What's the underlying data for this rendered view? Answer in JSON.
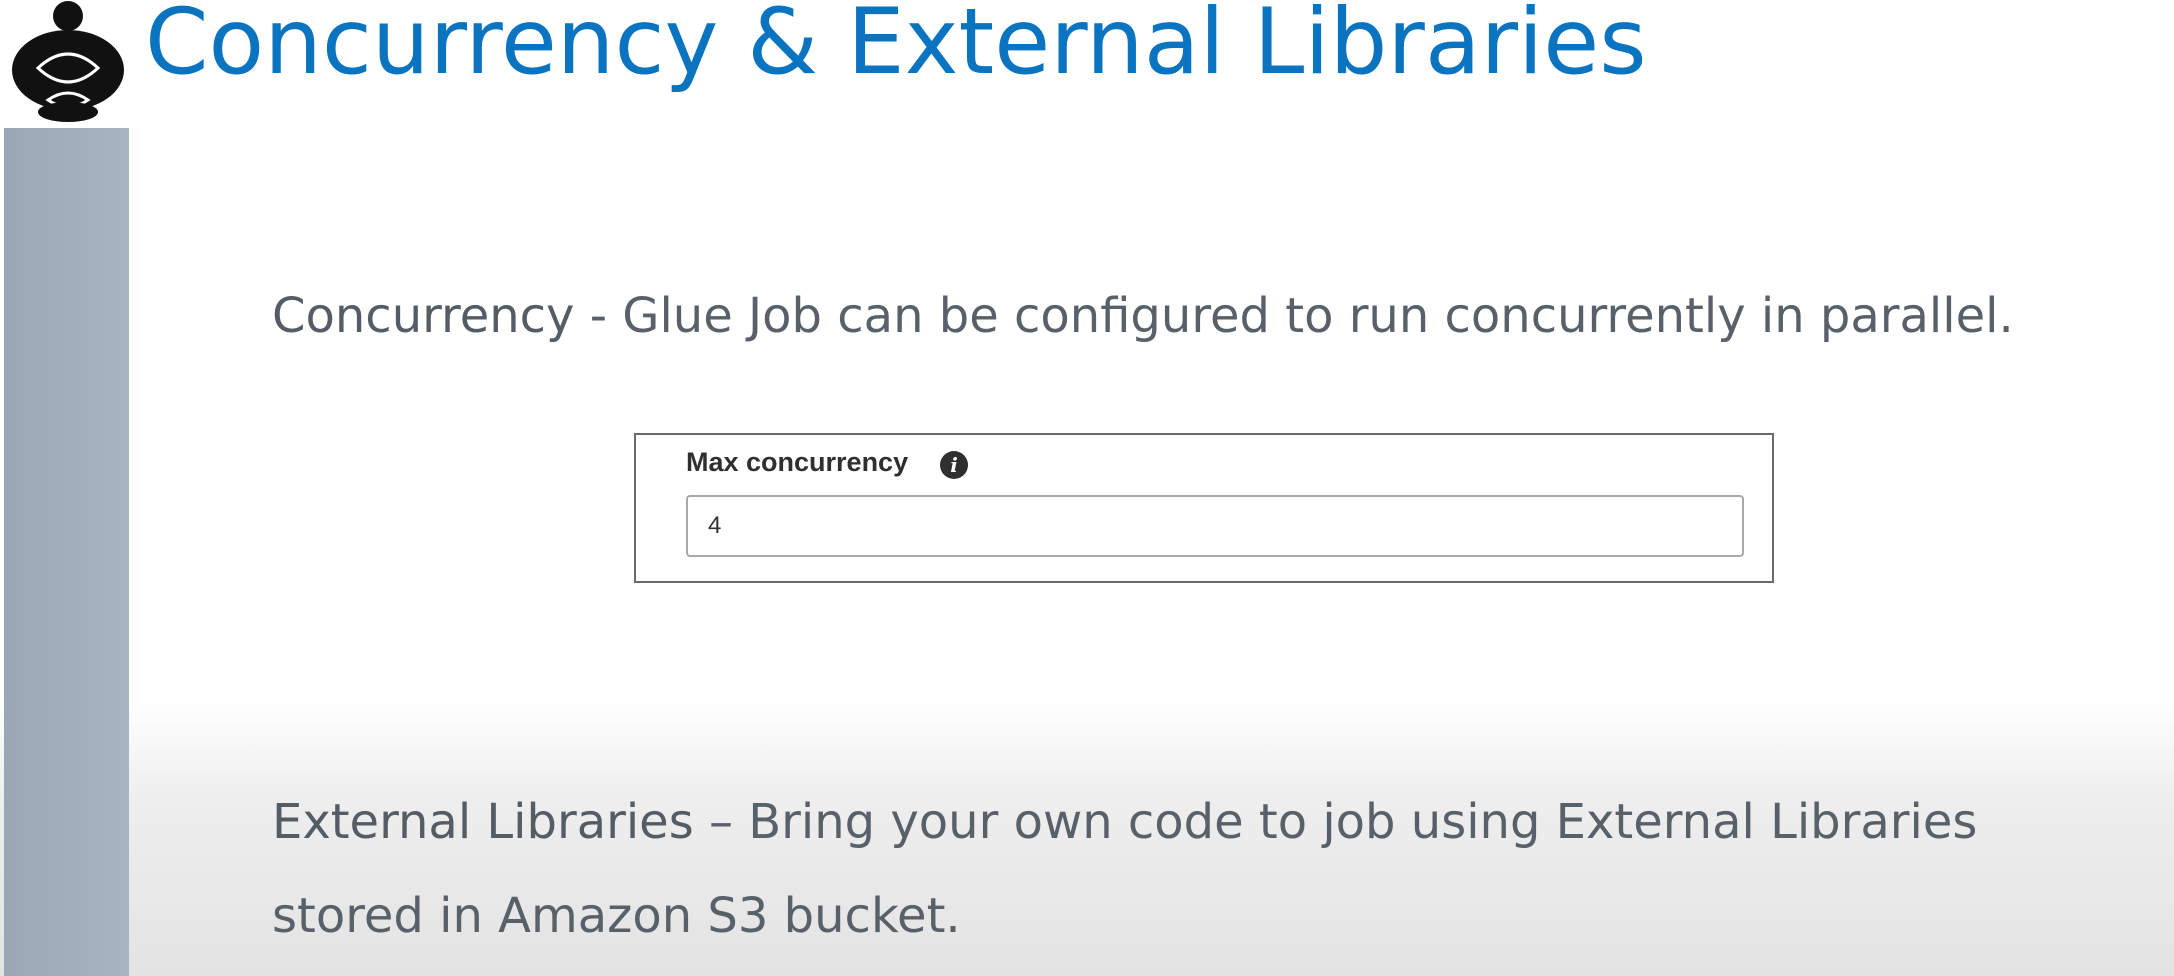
{
  "slide": {
    "title": "Concurrency & External Libraries",
    "concurrency": {
      "term": "Concurrency",
      "description": " - Glue Job can be configured to run concurrently in parallel."
    },
    "max_concurrency": {
      "label": "Max concurrency",
      "info_icon": "info-icon",
      "value": "4"
    },
    "external_libraries": {
      "term": "External Libraries",
      "description_line1": " – Bring your own code to job using External Libraries",
      "description_line2": "stored in Amazon S3 bucket."
    }
  },
  "colors": {
    "title": "#0b74c1",
    "body_text": "#58606a",
    "sidebar": "#a2afbc"
  }
}
